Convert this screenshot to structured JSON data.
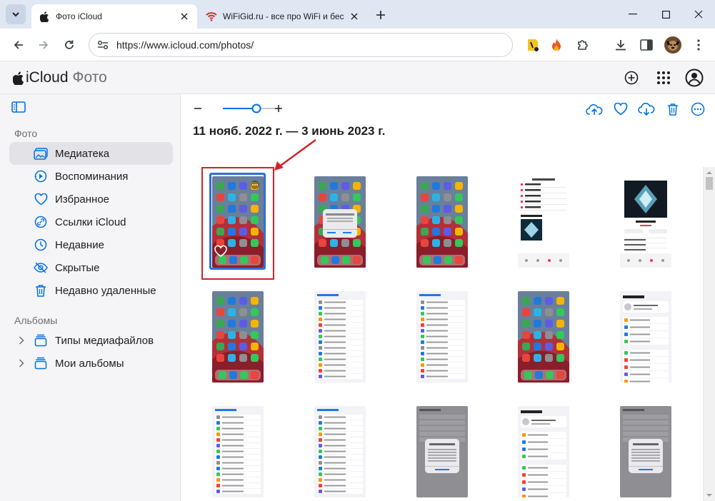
{
  "browser": {
    "tabs": [
      {
        "title": "Фото iCloud",
        "active": true,
        "favicon": "apple-icon"
      },
      {
        "title": "WiFiGid.ru - все про WiFi и бес",
        "active": false,
        "favicon": "wifi-icon"
      }
    ],
    "url": "https://www.icloud.com/photos/"
  },
  "app": {
    "brand_main": "iCloud",
    "brand_section": "Фото"
  },
  "sidebar": {
    "section_photos": "Фото",
    "items": [
      {
        "label": "Медиатека",
        "icon": "photo-library-icon",
        "selected": true
      },
      {
        "label": "Воспоминания",
        "icon": "memories-icon",
        "selected": false
      },
      {
        "label": "Избранное",
        "icon": "heart-icon",
        "selected": false
      },
      {
        "label": "Ссылки iCloud",
        "icon": "link-icon",
        "selected": false
      },
      {
        "label": "Недавние",
        "icon": "clock-icon",
        "selected": false
      },
      {
        "label": "Скрытые",
        "icon": "eye-slash-icon",
        "selected": false
      },
      {
        "label": "Недавно удаленные",
        "icon": "trash-icon",
        "selected": false
      }
    ],
    "section_albums": "Альбомы",
    "albums": [
      {
        "label": "Типы медиафайлов",
        "icon": "album-stack-icon"
      },
      {
        "label": "Мои альбомы",
        "icon": "album-stack-icon"
      }
    ]
  },
  "content": {
    "date_range": "11 нояб. 2022 г. — 3 июнь 2023 г.",
    "zoom_level": 0.5,
    "photos": [
      {
        "kind": "home",
        "selected": true
      },
      {
        "kind": "home-dialog"
      },
      {
        "kind": "home"
      },
      {
        "kind": "music-list"
      },
      {
        "kind": "music-album"
      },
      {
        "kind": "home"
      },
      {
        "kind": "settings-list"
      },
      {
        "kind": "settings-list"
      },
      {
        "kind": "home"
      },
      {
        "kind": "settings-profile"
      },
      {
        "kind": "settings-list"
      },
      {
        "kind": "settings-list"
      },
      {
        "kind": "gray-dialog"
      },
      {
        "kind": "settings-profile"
      },
      {
        "kind": "gray-dialog"
      }
    ]
  },
  "colors": {
    "accent": "#0071e3",
    "annotation_red": "#d0242b"
  }
}
